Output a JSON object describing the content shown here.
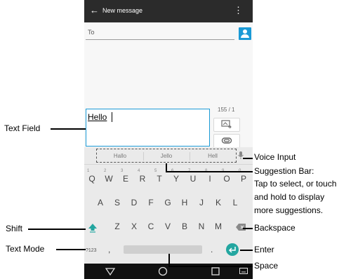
{
  "app_bar": {
    "title": "New message"
  },
  "recipient": {
    "placeholder": "To"
  },
  "message": {
    "text": "Hello",
    "counter": "155 / 1"
  },
  "keyboard": {
    "suggestions": [
      "Hallo",
      "Jello",
      "Hell"
    ],
    "row1": [
      {
        "letter": "Q",
        "num": "1"
      },
      {
        "letter": "W",
        "num": "2"
      },
      {
        "letter": "E",
        "num": "3"
      },
      {
        "letter": "R",
        "num": "4"
      },
      {
        "letter": "T",
        "num": "5"
      },
      {
        "letter": "Y",
        "num": "6"
      },
      {
        "letter": "U",
        "num": "7"
      },
      {
        "letter": "I",
        "num": "8"
      },
      {
        "letter": "O",
        "num": "9"
      },
      {
        "letter": "P",
        "num": "0"
      }
    ],
    "row2": [
      "A",
      "S",
      "D",
      "F",
      "G",
      "H",
      "J",
      "K",
      "L"
    ],
    "row3": [
      "Z",
      "X",
      "C",
      "V",
      "B",
      "N",
      "M"
    ],
    "mode_label": "?123",
    "comma": ",",
    "period": ".",
    "accent_color": "#23a6a0"
  },
  "callouts": {
    "text_field": "Text Field",
    "voice_input": "Voice Input",
    "suggestion_bar": "Suggestion Bar:",
    "suggestion_desc_1": "Tap to select, or touch",
    "suggestion_desc_2": "and hold to display",
    "suggestion_desc_3": "more suggestions.",
    "shift": "Shift",
    "backspace": "Backspace",
    "text_mode": "Text Mode",
    "enter": "Enter",
    "space": "Space"
  },
  "icons": {
    "back": "arrow-left-icon",
    "menu": "overflow-menu-icon",
    "contact": "person-icon",
    "attach_media": "media-icon",
    "attach": "paperclip-icon",
    "mic": "mic-icon",
    "shift": "shift-arrow-icon",
    "backspace": "backspace-icon",
    "enter": "enter-icon",
    "nav_back": "nav-back-icon",
    "nav_home": "nav-home-icon",
    "nav_recent": "nav-recent-icon",
    "nav_keyboard": "keyboard-icon"
  }
}
